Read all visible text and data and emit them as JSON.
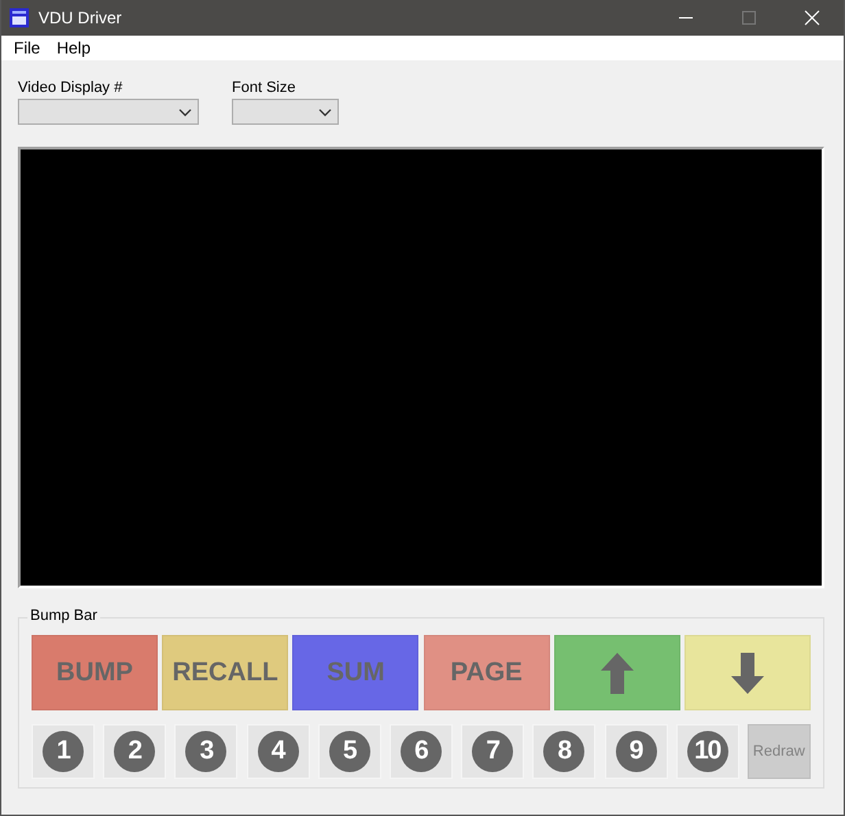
{
  "window": {
    "title": "VDU Driver"
  },
  "menu": [
    "File",
    "Help"
  ],
  "fields": [
    {
      "label": "Video Display #"
    },
    {
      "label": "Font Size"
    }
  ],
  "bump_bar": {
    "title": "Bump Bar",
    "buttons": [
      {
        "kind": "text",
        "label": "BUMP",
        "color": "#d97b6c"
      },
      {
        "kind": "text",
        "label": "RECALL",
        "color": "#dfca7e"
      },
      {
        "kind": "text",
        "label": "SUM",
        "color": "#6767e6"
      },
      {
        "kind": "text",
        "label": "PAGE",
        "color": "#e09084"
      },
      {
        "kind": "up",
        "color": "#76bf70"
      },
      {
        "kind": "down",
        "color": "#e8e59c"
      }
    ],
    "number_keys": [
      "1",
      "2",
      "3",
      "4",
      "5",
      "6",
      "7",
      "8",
      "9",
      "10"
    ],
    "redraw": {
      "label": "Redraw",
      "disabled": true
    }
  }
}
